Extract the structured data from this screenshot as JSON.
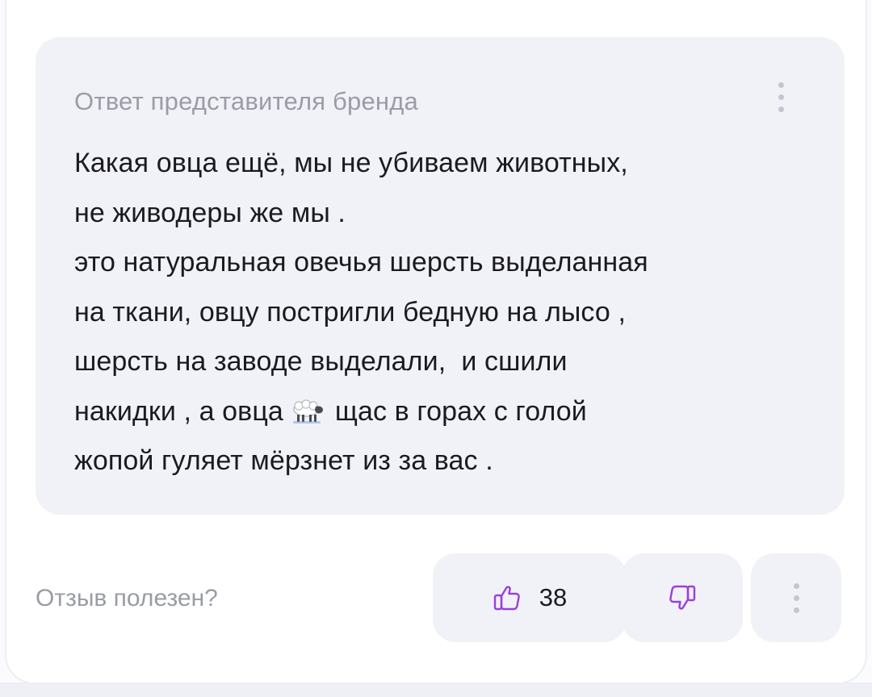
{
  "reply": {
    "title": "Ответ представителя бренда",
    "lines": [
      "Какая овца ещё, мы не убиваем животных,",
      "не живодеры же мы .",
      "это натуральная овечья шерсть выделанная",
      "на ткани, овцу постригли бедную на лысо ,",
      "шерсть на заводе выделали,  и сшили",
      "накидки , а овца",
      "щас в горах с голой",
      "жопой гуляет мёрзнет из за вас ."
    ],
    "emoji_icon": "sheep-icon"
  },
  "footer": {
    "helpful_question": "Отзыв полезен?",
    "like_count": "38",
    "like_icon": "thumbs-up-icon",
    "dislike_icon": "thumbs-down-icon",
    "more_icon": "more-vertical-icon"
  },
  "colors": {
    "card_background": "#f1f2f7",
    "thumb_icon": "#9b3fd9",
    "muted_text": "#9a9ca6",
    "body_text": "#1b1b1f"
  }
}
